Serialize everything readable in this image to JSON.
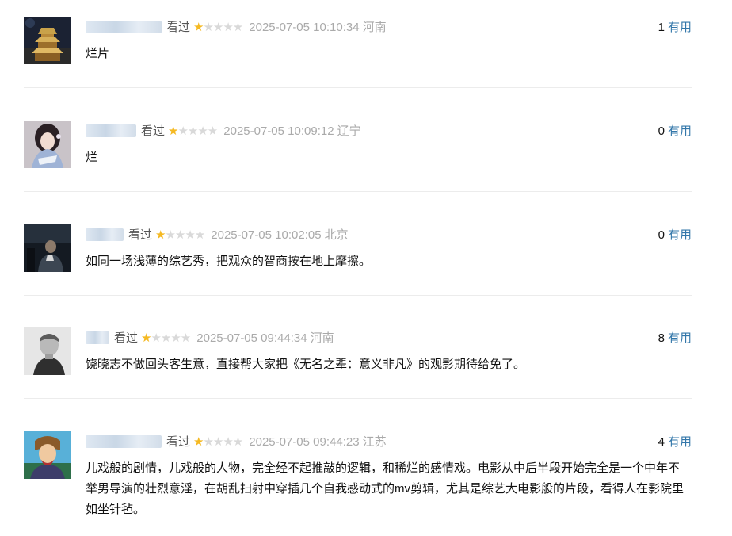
{
  "reviews": [
    {
      "user_name": "用户名已模糊",
      "status": "看过",
      "rating": 1,
      "max_rating": 5,
      "time": "2025-07-05 10:10:34",
      "location": "河南",
      "useful_count": "1",
      "useful_label": "有用",
      "content": "烂片"
    },
    {
      "user_name": "用户名已模糊",
      "status": "看过",
      "rating": 1,
      "max_rating": 5,
      "time": "2025-07-05 10:09:12",
      "location": "辽宁",
      "useful_count": "0",
      "useful_label": "有用",
      "content": "烂"
    },
    {
      "user_name": "用户名已模糊",
      "status": "看过",
      "rating": 1,
      "max_rating": 5,
      "time": "2025-07-05 10:02:05",
      "location": "北京",
      "useful_count": "0",
      "useful_label": "有用",
      "content": "如同一场浅薄的综艺秀，把观众的智商按在地上摩擦。"
    },
    {
      "user_name": "用户名已模糊",
      "status": "看过",
      "rating": 1,
      "max_rating": 5,
      "time": "2025-07-05 09:44:34",
      "location": "河南",
      "useful_count": "8",
      "useful_label": "有用",
      "content": "饶晓志不做回头客生意，直接帮大家把《无名之辈：意义非凡》的观影期待给免了。"
    },
    {
      "user_name": "用户名已模糊",
      "status": "看过",
      "rating": 1,
      "max_rating": 5,
      "time": "2025-07-05 09:44:23",
      "location": "江苏",
      "useful_count": "4",
      "useful_label": "有用",
      "content": "儿戏般的剧情，儿戏般的人物，完全经不起推敲的逻辑，和稀烂的感情戏。电影从中后半段开始完全是一个中年不举男导演的壮烈意淫，在胡乱扫射中穿插几个自我感动式的mv剪辑，尤其是综艺大电影般的片段，看得人在影院里如坐针毡。"
    }
  ],
  "colors": {
    "star_filled": "#f5b922",
    "star_empty": "#d9d9d9",
    "link": "#3377aa",
    "meta_gray": "#aaaaaa"
  }
}
